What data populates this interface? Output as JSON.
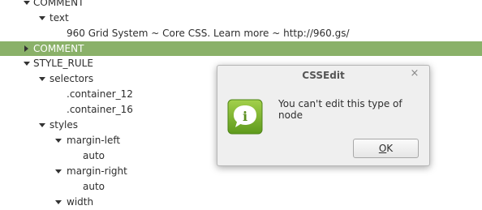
{
  "tree": {
    "rows": [
      {
        "label": "COMMENT"
      },
      {
        "label": "text"
      },
      {
        "label": "960 Grid System ~ Core CSS. Learn more ~ http://960.gs/"
      },
      {
        "label": "COMMENT"
      },
      {
        "label": "STYLE_RULE"
      },
      {
        "label": "selectors"
      },
      {
        "label": ".container_12"
      },
      {
        "label": ".container_16"
      },
      {
        "label": "styles"
      },
      {
        "label": "margin-left"
      },
      {
        "label": "auto"
      },
      {
        "label": "margin-right"
      },
      {
        "label": "auto"
      },
      {
        "label": "width"
      }
    ]
  },
  "dialog": {
    "title": "CSSEdit",
    "close_glyph": "×",
    "message": "You can't edit this type of node",
    "ok_mnemonic": "O",
    "ok_rest": "K",
    "icon": "info-icon",
    "icon_glyph": "i"
  },
  "colors": {
    "selection": "#8ab169",
    "icon_green": "#7ab526"
  }
}
